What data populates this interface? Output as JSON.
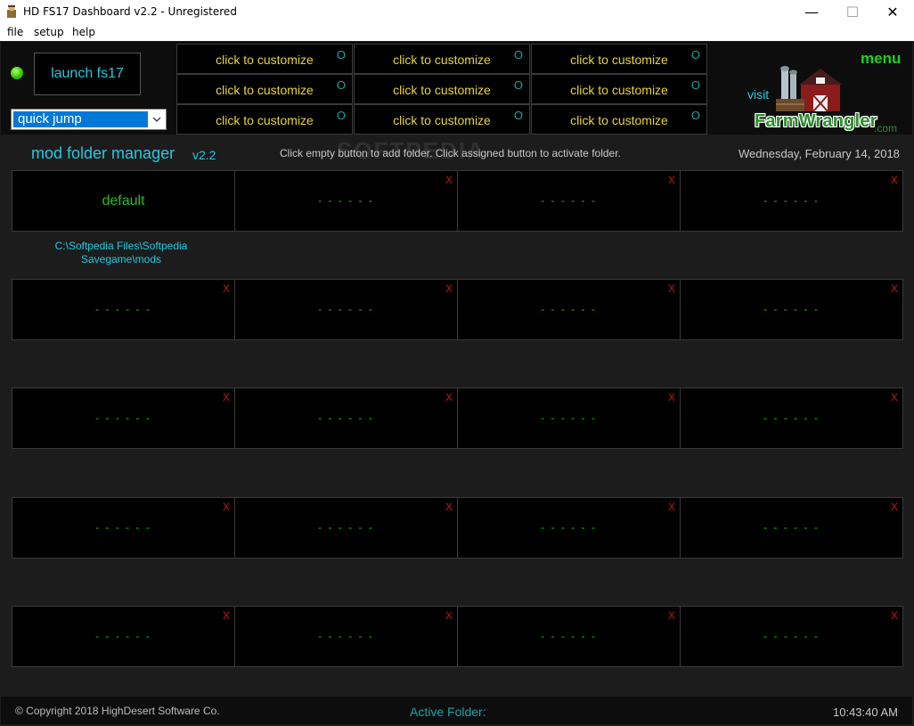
{
  "window": {
    "title": "HD FS17 Dashboard v2.2 - Unregistered",
    "controls": {
      "minimize": "—",
      "maximize": "☐",
      "close": "✕"
    }
  },
  "menubar": [
    "file",
    "setup",
    "help"
  ],
  "top": {
    "launch_label": "launch fs17",
    "status_color": "#33cc00",
    "quick_jump": "quick jump",
    "custom_buttons": [
      {
        "label": "click to customize",
        "indicator": "O"
      },
      {
        "label": "click to customize",
        "indicator": "O"
      },
      {
        "label": "click to customize",
        "indicator": "O"
      },
      {
        "label": "click to customize",
        "indicator": "O"
      },
      {
        "label": "click to customize",
        "indicator": "O"
      },
      {
        "label": "click to customize",
        "indicator": "O"
      },
      {
        "label": "click to customize",
        "indicator": "O"
      },
      {
        "label": "click to customize",
        "indicator": "O"
      },
      {
        "label": "click to customize",
        "indicator": "O"
      }
    ],
    "menu_label": "menu",
    "visit_label": "visit",
    "logo_text": "FarmWrangler",
    "logo_suffix": ".com"
  },
  "manager": {
    "title": "mod folder manager",
    "version": "v2.2",
    "instructions": "Click empty button to add folder. Click assigned button to activate folder.",
    "watermark": "SOFTPEDIA",
    "date": "Wednesday, February 14, 2018",
    "default_label": "default",
    "default_path_line1": "C:\\Softpedia Files\\Softpedia",
    "default_path_line2": "Savegame\\mods",
    "empty_label": "- - - - - -",
    "remove_label": "X"
  },
  "footer": {
    "copyright": "© Copyright 2018 HighDesert Software Co.",
    "active_folder_label": "Active Folder:",
    "time": "10:43:40 AM"
  },
  "colors": {
    "cyan": "#22c9e0",
    "yellow": "#e8d43b",
    "green": "#20c020",
    "red": "#c21818",
    "teal": "#1aa3a3"
  }
}
